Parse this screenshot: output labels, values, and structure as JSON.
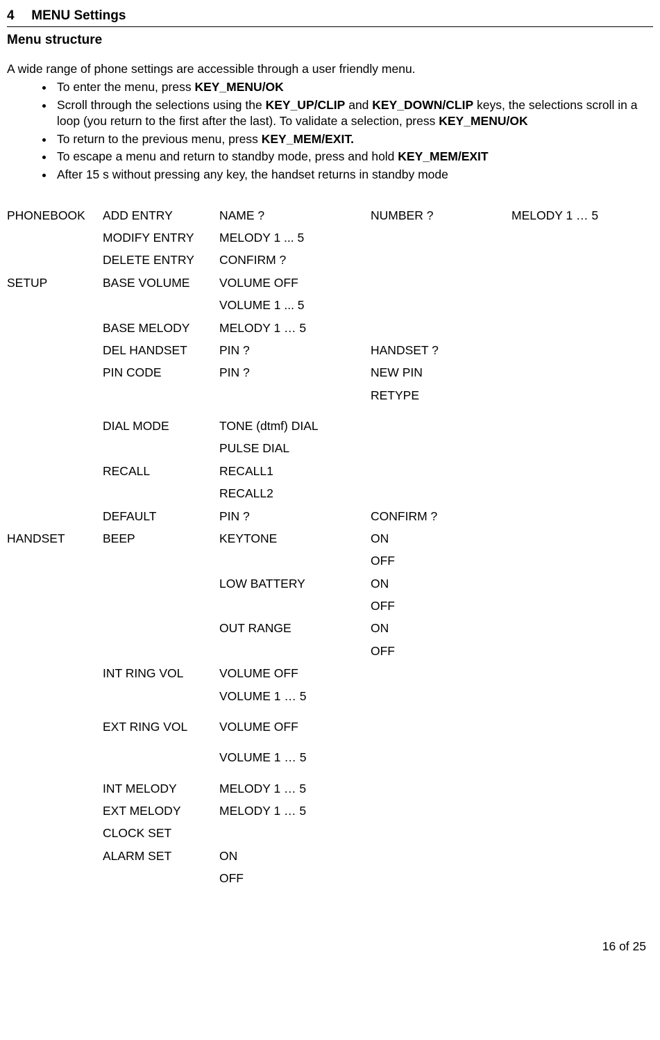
{
  "section": {
    "num": "4",
    "title": "MENU Settings"
  },
  "subheader": "Menu structure",
  "intro": "A wide range of phone settings are accessible through a user friendly menu.",
  "bullets": {
    "b1a": "To enter the menu, press ",
    "b1b": "KEY_MENU/OK",
    "b2a": "Scroll through the selections using the ",
    "b2b": "KEY_UP/CLIP",
    "b2c": " and ",
    "b2d": "KEY_DOWN/CLIP",
    "b2e": " keys, the selections scroll in a loop (you return to the first after the last). To validate a selection, press ",
    "b2f": "KEY_MENU/OK",
    "b3a": "To return to the previous menu, press ",
    "b3b": "KEY_MEM/EXIT.",
    "b4a": "To escape a menu and return to standby mode, press and hold ",
    "b4b": "KEY_MEM/EXIT",
    "b5": "After 15 s without pressing any key, the handset returns in standby mode"
  },
  "rows": [
    [
      "PHONEBOOK",
      "ADD ENTRY",
      "NAME ?",
      "NUMBER ?",
      "MELODY 1 … 5"
    ],
    [
      "",
      "MODIFY ENTRY",
      "MELODY 1 ... 5",
      "",
      ""
    ],
    [
      "",
      "DELETE ENTRY",
      "CONFIRM ?",
      "",
      ""
    ],
    [
      "SETUP",
      "BASE VOLUME",
      "VOLUME OFF",
      "",
      ""
    ],
    [
      "",
      "",
      "VOLUME 1 ... 5",
      "",
      ""
    ],
    [
      "",
      "BASE MELODY",
      "MELODY 1 … 5",
      "",
      ""
    ],
    [
      "",
      "DEL HANDSET",
      "PIN ?",
      "HANDSET ?",
      ""
    ],
    [
      "",
      "PIN CODE",
      "PIN ?",
      "NEW PIN",
      ""
    ],
    [
      "",
      "",
      "",
      "RETYPE",
      ""
    ],
    [
      "GAP"
    ],
    [
      "",
      "DIAL MODE",
      "TONE (dtmf) DIAL",
      "",
      ""
    ],
    [
      "",
      "",
      "PULSE DIAL",
      "",
      ""
    ],
    [
      "",
      "RECALL",
      "RECALL1",
      "",
      ""
    ],
    [
      "",
      "",
      "RECALL2",
      "",
      ""
    ],
    [
      "",
      "DEFAULT",
      "PIN ?",
      "CONFIRM ?",
      ""
    ],
    [
      "HANDSET",
      "BEEP",
      "KEYTONE",
      "ON",
      ""
    ],
    [
      "",
      "",
      "",
      "OFF",
      ""
    ],
    [
      "",
      "",
      "LOW BATTERY",
      "ON",
      ""
    ],
    [
      "",
      "",
      "",
      "OFF",
      ""
    ],
    [
      "",
      "",
      "OUT RANGE",
      "ON",
      ""
    ],
    [
      "",
      "",
      "",
      "OFF",
      ""
    ],
    [
      "",
      "INT RING VOL",
      "VOLUME OFF",
      "",
      ""
    ],
    [
      "",
      "",
      "VOLUME 1 … 5",
      "",
      ""
    ],
    [
      "GAP"
    ],
    [
      "",
      "EXT RING VOL",
      "VOLUME OFF",
      "",
      ""
    ],
    [
      "GAP"
    ],
    [
      "",
      "",
      "VOLUME 1 … 5",
      "",
      ""
    ],
    [
      "GAP"
    ],
    [
      "",
      "INT MELODY",
      "MELODY 1 … 5",
      "",
      ""
    ],
    [
      "",
      "EXT MELODY",
      "MELODY 1 … 5",
      "",
      ""
    ],
    [
      "",
      "CLOCK SET",
      "",
      "",
      ""
    ],
    [
      "",
      "ALARM SET",
      "ON",
      "",
      ""
    ],
    [
      "",
      "",
      "OFF",
      "",
      ""
    ]
  ],
  "footer": "16 of 25"
}
